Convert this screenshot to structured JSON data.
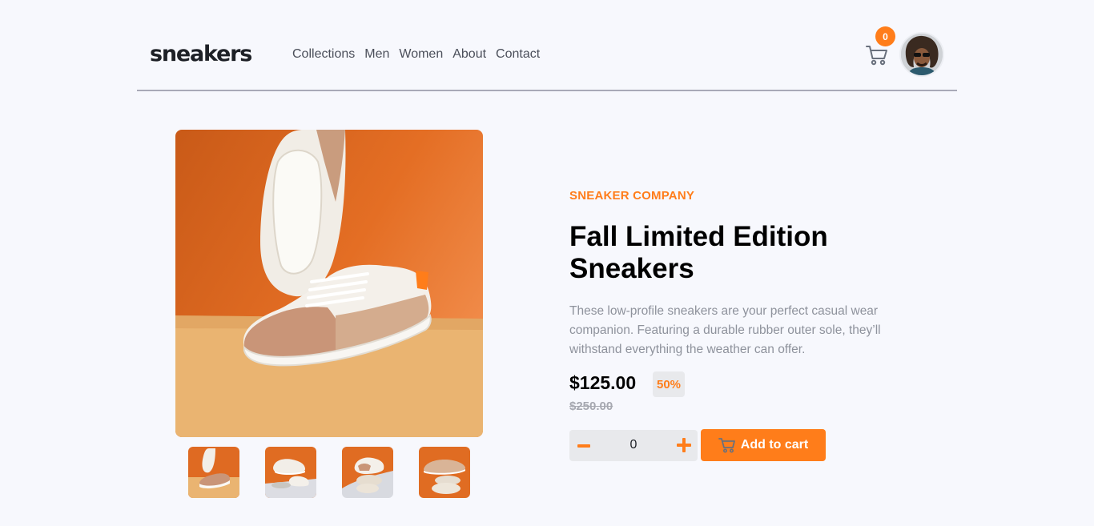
{
  "brand": {
    "logo": "sneakers"
  },
  "nav": {
    "items": [
      "Collections",
      "Men",
      "Women",
      "About",
      "Contact"
    ]
  },
  "cart": {
    "count": "0",
    "icon": "cart-icon"
  },
  "user": {
    "avatar_icon": "avatar"
  },
  "gallery": {
    "thumbnails": 4
  },
  "product": {
    "company": "SNEAKER COMPANY",
    "title": "Fall Limited Edition Sneakers",
    "description": "These low-profile sneakers are your perfect casual wear companion. Featuring a durable rubber outer sole, they’ll withstand everything the weather can offer.",
    "price": "$125.00",
    "discount": "50%",
    "old_price": "$250.00"
  },
  "quantity": {
    "value": "0"
  },
  "actions": {
    "add_to_cart": "Add to cart"
  },
  "colors": {
    "accent": "#ff7d1a",
    "background": "#f7f8fd",
    "text": "#1d2026",
    "muted": "#8e929c"
  }
}
